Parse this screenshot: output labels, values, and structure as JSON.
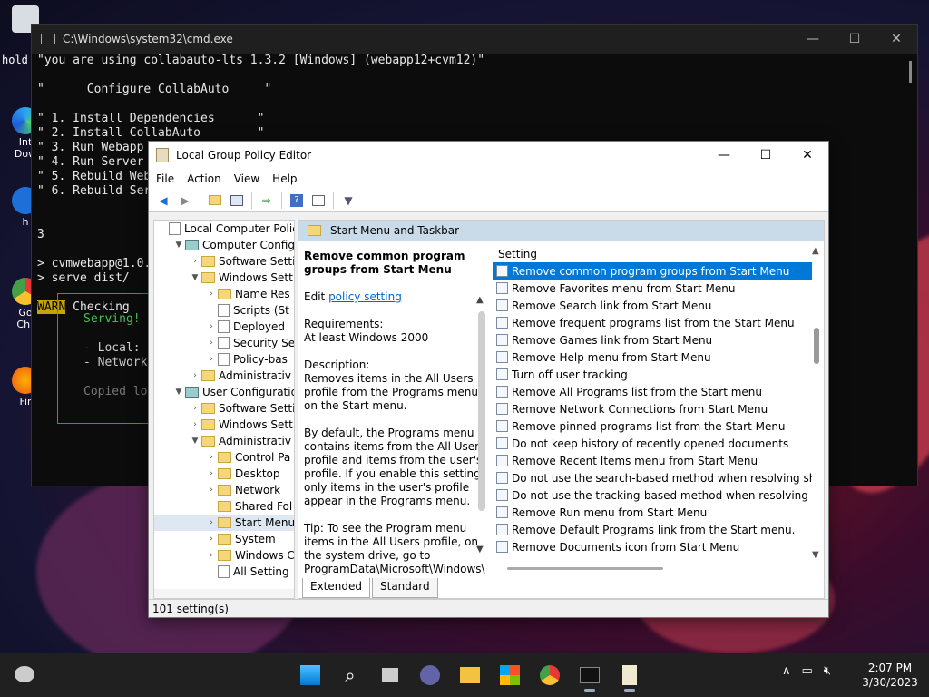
{
  "desktop": {
    "icons": [
      {
        "label": "Int\nDow",
        "icon": "edge-icon"
      },
      {
        "label": "3",
        "icon": "edge-icon"
      },
      {
        "label": "h",
        "icon": "app-icon"
      },
      {
        "label": "Go\nChr",
        "icon": "chrome-icon"
      },
      {
        "label": "Fir",
        "icon": "firefox-icon"
      }
    ]
  },
  "cmd": {
    "title": "C:\\Windows\\system32\\cmd.exe",
    "hold_text": "hold",
    "lines": [
      "\"you are using collabauto-lts 1.3.2 [Windows] (webapp12+cvm12)\"",
      "",
      "\"      Configure CollabAuto     \"",
      "",
      "\" 1. Install Dependencies      \"",
      "\" 2. Install CollabAuto        \"",
      "\" 3. Run Webapp",
      "\" 4. Run Server",
      "\" 5. Rebuild Web",
      "\" 6. Rebuild Ser",
      "",
      "",
      "3",
      "",
      "> cvmwebapp@1.0.",
      "> serve dist/",
      ""
    ],
    "warn_label": "WARN",
    "warn_text": " Checking",
    "serve_box": {
      "serving": "Serving!",
      "local": "- Local:",
      "network": "- Network",
      "copied": "Copied lo"
    }
  },
  "gpedit": {
    "title": "Local Group Policy Editor",
    "menu": [
      "File",
      "Action",
      "View",
      "Help"
    ],
    "tree": [
      {
        "label": "Local Computer Polic",
        "indent": 0,
        "arrow": "",
        "icon": "doc"
      },
      {
        "label": "Computer Config",
        "indent": 1,
        "arrow": "▼",
        "icon": "pc"
      },
      {
        "label": "Software Setti",
        "indent": 2,
        "arrow": "›",
        "icon": "fold"
      },
      {
        "label": "Windows Sett",
        "indent": 2,
        "arrow": "▼",
        "icon": "fold"
      },
      {
        "label": "Name Res",
        "indent": 3,
        "arrow": "›",
        "icon": "fold"
      },
      {
        "label": "Scripts (St",
        "indent": 3,
        "arrow": "",
        "icon": "doc"
      },
      {
        "label": "Deployed",
        "indent": 3,
        "arrow": "›",
        "icon": "doc"
      },
      {
        "label": "Security Se",
        "indent": 3,
        "arrow": "›",
        "icon": "doc"
      },
      {
        "label": "Policy-bas",
        "indent": 3,
        "arrow": "›",
        "icon": "doc"
      },
      {
        "label": "Administrativ",
        "indent": 2,
        "arrow": "›",
        "icon": "fold"
      },
      {
        "label": "User Configuratio",
        "indent": 1,
        "arrow": "▼",
        "icon": "pc"
      },
      {
        "label": "Software Setti",
        "indent": 2,
        "arrow": "›",
        "icon": "fold"
      },
      {
        "label": "Windows Sett",
        "indent": 2,
        "arrow": "›",
        "icon": "fold"
      },
      {
        "label": "Administrativ",
        "indent": 2,
        "arrow": "▼",
        "icon": "fold"
      },
      {
        "label": "Control Pa",
        "indent": 3,
        "arrow": "›",
        "icon": "fold"
      },
      {
        "label": "Desktop",
        "indent": 3,
        "arrow": "›",
        "icon": "fold"
      },
      {
        "label": "Network",
        "indent": 3,
        "arrow": "›",
        "icon": "fold"
      },
      {
        "label": "Shared Fol",
        "indent": 3,
        "arrow": "",
        "icon": "fold"
      },
      {
        "label": "Start Menu",
        "indent": 3,
        "arrow": "›",
        "icon": "fold",
        "selected": true
      },
      {
        "label": "System",
        "indent": 3,
        "arrow": "›",
        "icon": "fold"
      },
      {
        "label": "Windows C",
        "indent": 3,
        "arrow": "›",
        "icon": "fold"
      },
      {
        "label": "All Setting",
        "indent": 3,
        "arrow": "",
        "icon": "doc"
      }
    ],
    "header": "Start Menu and Taskbar",
    "description": {
      "title": "Remove common program groups from Start Menu",
      "edit_prefix": "Edit ",
      "edit_link": "policy setting ",
      "requirements_label": "Requirements:",
      "requirements": "At least Windows 2000",
      "description_label": "Description:",
      "p1": "Removes items in the All Users profile from the Programs menu on the Start menu.",
      "p2": "By default, the Programs menu contains items from the All Users profile and items from the user's profile. If you enable this setting, only items in the user's profile appear in the Programs menu.",
      "p3": "Tip: To see the Program menu items in the All Users profile, on the system drive, go to ProgramData\\Microsoft\\Windows\\"
    },
    "list_header": "Setting",
    "settings": [
      "Remove common program groups from Start Menu",
      "Remove Favorites menu from Start Menu",
      "Remove Search link from Start Menu",
      "Remove frequent programs list from the Start Menu",
      "Remove Games link from Start Menu",
      "Remove Help menu from Start Menu",
      "Turn off user tracking",
      "Remove All Programs list from the Start menu",
      "Remove Network Connections from Start Menu",
      "Remove pinned programs list from the Start Menu",
      "Do not keep history of recently opened documents",
      "Remove Recent Items menu from Start Menu",
      "Do not use the search-based method when resolving shell s...",
      "Do not use the tracking-based method when resolving shell ...",
      "Remove Run menu from Start Menu",
      "Remove Default Programs link from the Start menu.",
      "Remove Documents icon from Start Menu"
    ],
    "tabs": [
      "Extended",
      "Standard"
    ],
    "status": "101 setting(s)"
  },
  "taskbar": {
    "time": "2:07 PM",
    "date": "3/30/2023",
    "apps": [
      "start-icon",
      "search-icon",
      "task-view-icon",
      "teams-icon",
      "file-explorer-icon",
      "store-icon",
      "chrome-icon",
      "terminal-icon",
      "notepad-icon"
    ]
  },
  "colors": {
    "selection": "#0078d7",
    "header": "#c9dbe9",
    "taskbar": "#202020"
  }
}
